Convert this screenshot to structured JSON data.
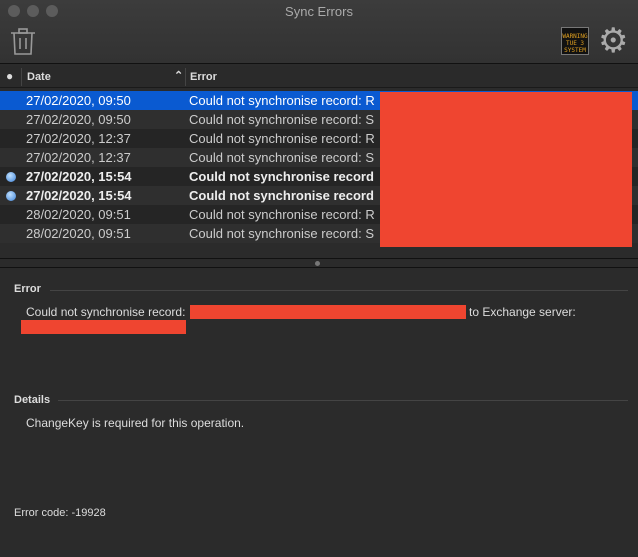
{
  "window": {
    "title": "Sync Errors"
  },
  "toolbar": {
    "warning_icon_text": "WARNING TUE 3 SYSTEM"
  },
  "table": {
    "columns": [
      "Date",
      "Error"
    ],
    "rows": [
      {
        "date": "27/02/2020, 09:50",
        "error": "Could not synchronise record: R",
        "unread": false,
        "selected": true
      },
      {
        "date": "27/02/2020, 09:50",
        "error": "Could not synchronise record: S",
        "unread": false,
        "selected": false
      },
      {
        "date": "27/02/2020, 12:37",
        "error": "Could not synchronise record: R",
        "unread": false,
        "selected": false
      },
      {
        "date": "27/02/2020, 12:37",
        "error": "Could not synchronise record: S",
        "unread": false,
        "selected": false
      },
      {
        "date": "27/02/2020, 15:54",
        "error": "Could not synchronise record",
        "unread": true,
        "selected": false
      },
      {
        "date": "27/02/2020, 15:54",
        "error": "Could not synchronise record",
        "unread": true,
        "selected": false
      },
      {
        "date": "28/02/2020, 09:51",
        "error": "Could not synchronise record: R",
        "unread": false,
        "selected": false
      },
      {
        "date": "28/02/2020, 09:51",
        "error": "Could not synchronise record: S",
        "unread": false,
        "selected": false
      }
    ]
  },
  "detail": {
    "error_heading": "Error",
    "error_prefix": "Could not synchronise record:",
    "error_mid": "to Exchange server:",
    "details_heading": "Details",
    "details_text": "ChangeKey is required for this operation.",
    "error_code": "Error code: -19928"
  }
}
